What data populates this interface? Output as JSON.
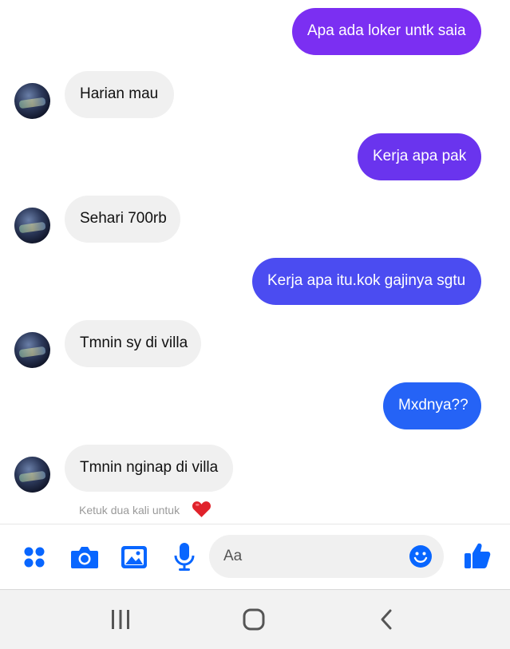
{
  "messages": [
    {
      "from": "me",
      "text": "Apa ada loker untk saia",
      "color": "#7b2ff2"
    },
    {
      "from": "them",
      "text": "Harian mau"
    },
    {
      "from": "me",
      "text": "Kerja apa pak",
      "color": "#6a34ee"
    },
    {
      "from": "them",
      "text": "Sehari 700rb"
    },
    {
      "from": "me",
      "text": "Kerja apa itu.kok gajinya sgtu",
      "color": "#4b4cf1"
    },
    {
      "from": "them",
      "text": "Tmnin sy di villa"
    },
    {
      "from": "me",
      "text": "Mxdnya??",
      "color": "#2563f6"
    },
    {
      "from": "them",
      "text": "Tmnin nginap di villa"
    }
  ],
  "reaction_hint": "Ketuk dua kali untuk",
  "composer": {
    "placeholder": "Aa",
    "icons": [
      "menu-dots-icon",
      "camera-icon",
      "gallery-icon",
      "microphone-icon",
      "emoji-icon",
      "thumbs-up-icon"
    ],
    "accent": "#0866ff"
  },
  "navbar": {
    "icons": [
      "recent-apps-icon",
      "home-icon",
      "back-icon"
    ]
  }
}
